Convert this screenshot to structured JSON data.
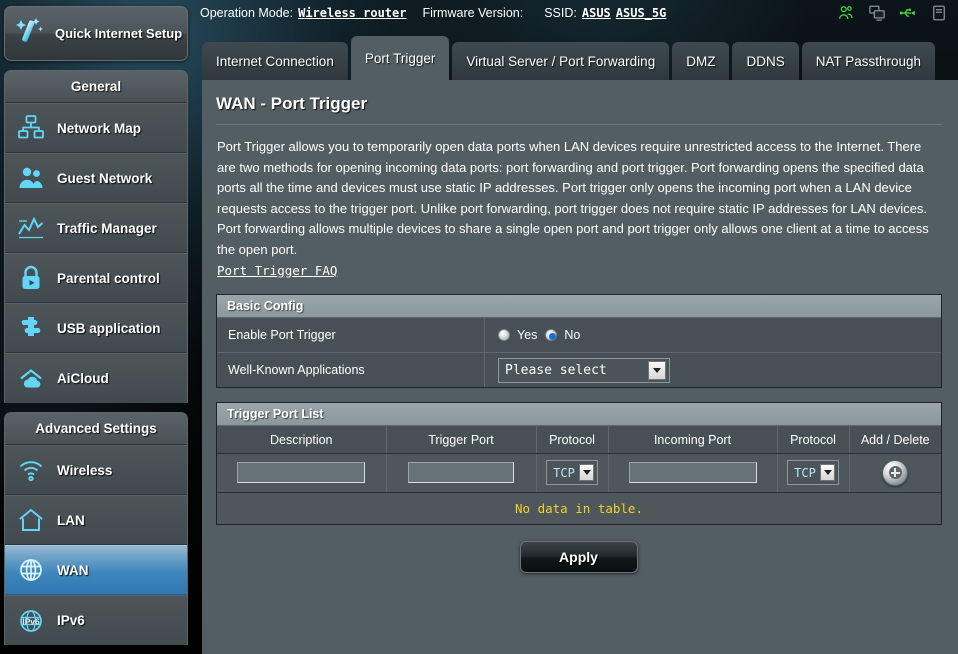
{
  "topbar": {
    "operation_mode_label": "Operation Mode:",
    "operation_mode_value": "Wireless router",
    "firmware_label": "Firmware Version:",
    "firmware_value": "",
    "ssid_label": "SSID:",
    "ssid_value_1": "ASUS",
    "ssid_value_2": "ASUS_5G",
    "icons": [
      {
        "name": "clients-icon",
        "color": "#3cdb3c"
      },
      {
        "name": "devices-icon",
        "color": "#8a9295"
      },
      {
        "name": "usb-icon",
        "color": "#3cdb3c"
      },
      {
        "name": "printer-icon",
        "color": "#8a9295"
      }
    ]
  },
  "sidebar": {
    "quick_setup": {
      "label": "Quick Internet Setup",
      "icon": "magic-wand-icon"
    },
    "groups": [
      {
        "title": "General",
        "items": [
          {
            "label": "Network Map",
            "icon": "network-map-icon",
            "active": false
          },
          {
            "label": "Guest Network",
            "icon": "guest-network-icon",
            "active": false
          },
          {
            "label": "Traffic Manager",
            "icon": "traffic-manager-icon",
            "active": false
          },
          {
            "label": "Parental control",
            "icon": "padlock-icon",
            "active": false
          },
          {
            "label": "USB application",
            "icon": "puzzle-icon",
            "active": false
          },
          {
            "label": "AiCloud",
            "icon": "cloud-icon",
            "active": false
          }
        ]
      },
      {
        "title": "Advanced Settings",
        "items": [
          {
            "label": "Wireless",
            "icon": "wifi-icon",
            "active": false
          },
          {
            "label": "LAN",
            "icon": "house-icon",
            "active": false
          },
          {
            "label": "WAN",
            "icon": "globe-icon",
            "active": true
          },
          {
            "label": "IPv6",
            "icon": "ipv6-globe-icon",
            "active": false
          }
        ]
      }
    ]
  },
  "tabs": [
    {
      "label": "Internet Connection",
      "active": false
    },
    {
      "label": "Port Trigger",
      "active": true
    },
    {
      "label": "Virtual Server / Port Forwarding",
      "active": false
    },
    {
      "label": "DMZ",
      "active": false
    },
    {
      "label": "DDNS",
      "active": false
    },
    {
      "label": "NAT Passthrough",
      "active": false
    }
  ],
  "main": {
    "page_title": "WAN - Port Trigger",
    "description": "Port Trigger allows you to temporarily open data ports when LAN devices require unrestricted access to the Internet. There are two methods for opening incoming data ports: port forwarding and port trigger. Port forwarding opens the specified data ports all the time and devices must use static IP addresses. Port trigger only opens the incoming port when a LAN device requests access to the trigger port. Unlike port forwarding, port trigger does not require static IP addresses for LAN devices. Port forwarding allows multiple devices to share a single open port and port trigger only allows one client at a time to access the open port.",
    "faq_link": "Port Trigger FAQ"
  },
  "basic_config": {
    "header": "Basic Config",
    "enable_label": "Enable Port Trigger",
    "radio_yes": "Yes",
    "radio_no": "No",
    "selected_radio": "No",
    "well_known_label": "Well-Known Applications",
    "well_known_value": "Please select"
  },
  "trigger_port_list": {
    "header": "Trigger Port List",
    "columns": [
      "Description",
      "Trigger Port",
      "Protocol",
      "Incoming Port",
      "Protocol",
      "Add / Delete"
    ],
    "entry_row": {
      "description_value": "",
      "trigger_port_value": "",
      "protocol_1_value": "TCP",
      "incoming_port_value": "",
      "protocol_2_value": "TCP",
      "add_button": "add-icon"
    },
    "empty_message": "No data in table.",
    "rows": []
  },
  "footer": {
    "apply_label": "Apply"
  },
  "colors": {
    "panel_bg": "#535e62",
    "accent_blue": "#3f86bc",
    "section_head": "#8b989c",
    "warning_yellow": "#f3d028",
    "icon_cyan": "#5fd3f5"
  }
}
